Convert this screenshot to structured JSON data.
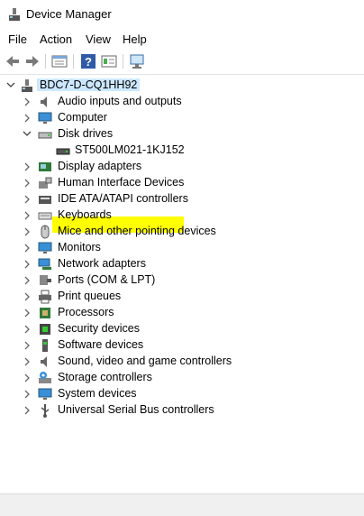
{
  "window": {
    "title": "Device Manager"
  },
  "menu": [
    "File",
    "Action",
    "View",
    "Help"
  ],
  "toolbar": [
    "back-icon",
    "forward-icon",
    "properties-icon",
    "help-icon",
    "view-icon",
    "scan-hardware-icon"
  ],
  "tree": {
    "root": "BDC7-D-CQ1HH92",
    "selected_child": "ST500LM021-1KJ152",
    "categories": [
      "Audio inputs and outputs",
      "Computer",
      "Disk drives",
      "Display adapters",
      "Human Interface Devices",
      "IDE ATA/ATAPI controllers",
      "Keyboards",
      "Mice and other pointing devices",
      "Monitors",
      "Network adapters",
      "Ports (COM & LPT)",
      "Print queues",
      "Processors",
      "Security devices",
      "Software devices",
      "Sound, video and game controllers",
      "Storage controllers",
      "System devices",
      "Universal Serial Bus controllers"
    ]
  },
  "colors": {
    "highlight": "#ffff00",
    "root_selection": "#cce8ff"
  }
}
